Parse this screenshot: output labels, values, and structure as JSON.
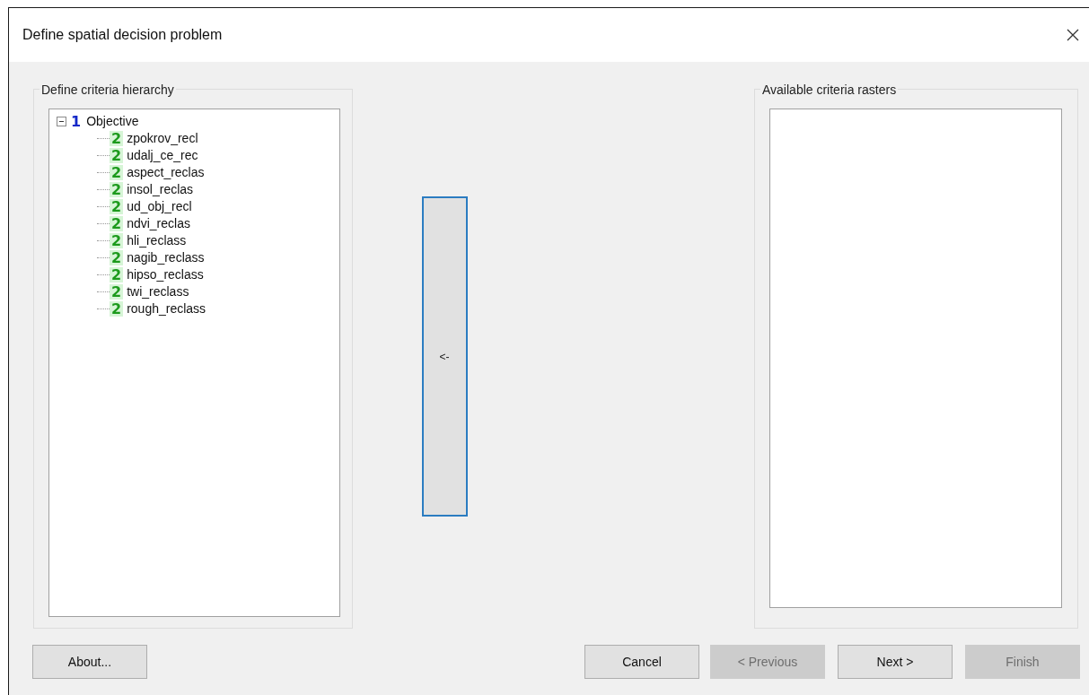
{
  "window": {
    "title": "Define spatial decision problem"
  },
  "hierarchy": {
    "title": "Define criteria hierarchy",
    "tree": [
      {
        "badge": "1",
        "label": "Objective",
        "expanded": true,
        "children": [
          {
            "badge": "2",
            "label": "zpokrov_recl"
          },
          {
            "badge": "2",
            "label": "udalj_ce_rec"
          },
          {
            "badge": "2",
            "label": "aspect_reclas"
          },
          {
            "badge": "2",
            "label": "insol_reclas"
          },
          {
            "badge": "2",
            "label": "ud_obj_recl"
          },
          {
            "badge": "2",
            "label": "ndvi_reclas"
          },
          {
            "badge": "2",
            "label": "hli_reclass"
          },
          {
            "badge": "2",
            "label": "nagib_reclass"
          },
          {
            "badge": "2",
            "label": "hipso_reclass"
          },
          {
            "badge": "2",
            "label": "twi_reclass"
          },
          {
            "badge": "2",
            "label": "rough_reclass"
          }
        ]
      }
    ]
  },
  "move_button": {
    "label": "<-"
  },
  "available": {
    "title": "Available criteria rasters"
  },
  "buttons": [
    {
      "label": "About...",
      "disabled": false
    },
    {
      "label": "Cancel",
      "disabled": false
    },
    {
      "label": "< Previous",
      "disabled": true
    },
    {
      "label": "Next >",
      "disabled": false
    },
    {
      "label": "Finish",
      "disabled": true
    }
  ]
}
